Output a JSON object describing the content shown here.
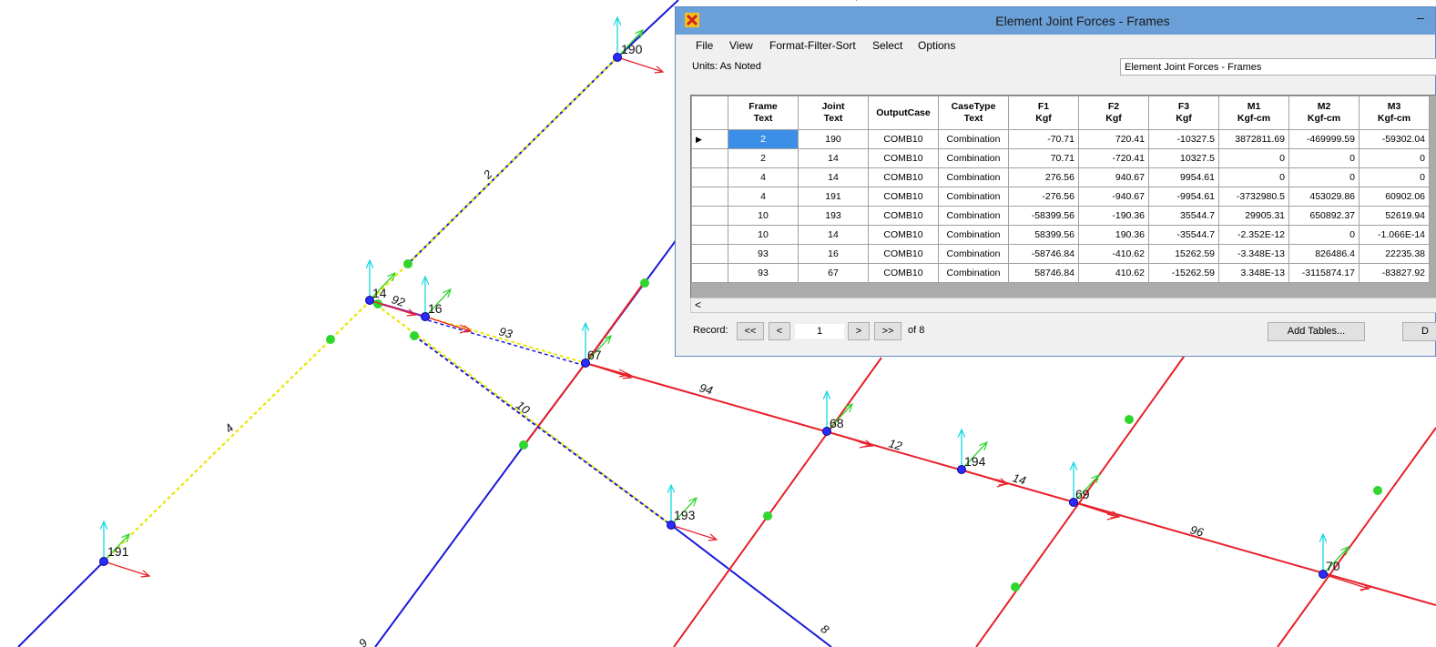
{
  "window": {
    "title": "Element Joint Forces - Frames",
    "menu": [
      "File",
      "View",
      "Format-Filter-Sort",
      "Select",
      "Options"
    ],
    "units_label": "Units:",
    "units_value": "As Noted",
    "table_selector": "Element Joint Forces - Frames",
    "minimize": "–"
  },
  "grid": {
    "columns": [
      {
        "name": "Frame",
        "unit": "Text"
      },
      {
        "name": "Joint",
        "unit": "Text"
      },
      {
        "name": "OutputCase",
        "unit": ""
      },
      {
        "name": "CaseType",
        "unit": "Text"
      },
      {
        "name": "F1",
        "unit": "Kgf"
      },
      {
        "name": "F2",
        "unit": "Kgf"
      },
      {
        "name": "F3",
        "unit": "Kgf"
      },
      {
        "name": "M1",
        "unit": "Kgf-cm"
      },
      {
        "name": "M2",
        "unit": "Kgf-cm"
      },
      {
        "name": "M3",
        "unit": "Kgf-cm"
      }
    ],
    "rows": [
      [
        "2",
        "190",
        "COMB10",
        "Combination",
        "-70.71",
        "720.41",
        "-10327.5",
        "3872811.69",
        "-469999.59",
        "-59302.04"
      ],
      [
        "2",
        "14",
        "COMB10",
        "Combination",
        "70.71",
        "-720.41",
        "10327.5",
        "0",
        "0",
        "0"
      ],
      [
        "4",
        "14",
        "COMB10",
        "Combination",
        "276.56",
        "940.67",
        "9954.61",
        "0",
        "0",
        "0"
      ],
      [
        "4",
        "191",
        "COMB10",
        "Combination",
        "-276.56",
        "-940.67",
        "-9954.61",
        "-3732980.5",
        "453029.86",
        "60902.06"
      ],
      [
        "10",
        "193",
        "COMB10",
        "Combination",
        "-58399.56",
        "-190.36",
        "35544.7",
        "29905.31",
        "650892.37",
        "52619.94"
      ],
      [
        "10",
        "14",
        "COMB10",
        "Combination",
        "58399.56",
        "190.36",
        "-35544.7",
        "-2.352E-12",
        "0",
        "-1.066E-14"
      ],
      [
        "93",
        "16",
        "COMB10",
        "Combination",
        "-58746.84",
        "-410.62",
        "15262.59",
        "-3.348E-13",
        "826486.4",
        "22235.38"
      ],
      [
        "93",
        "67",
        "COMB10",
        "Combination",
        "58746.84",
        "410.62",
        "-15262.59",
        "3.348E-13",
        "-3115874.17",
        "-83827.92"
      ]
    ],
    "selected_row_marker": "▶",
    "scroll_left": "<"
  },
  "record_nav": {
    "label": "Record:",
    "first": "<<",
    "prev": "<",
    "current": "1",
    "next": ">",
    "last": ">>",
    "of_text": "of 8"
  },
  "buttons": {
    "add_tables": "Add Tables...",
    "done_partial": "D"
  },
  "model": {
    "joints": [
      "190",
      "14",
      "16",
      "67",
      "68",
      "194",
      "69",
      "70",
      "191",
      "193"
    ],
    "frame_labels": [
      "2",
      "4",
      "92",
      "93",
      "10",
      "94",
      "12",
      "14",
      "96",
      "8",
      "9"
    ]
  }
}
